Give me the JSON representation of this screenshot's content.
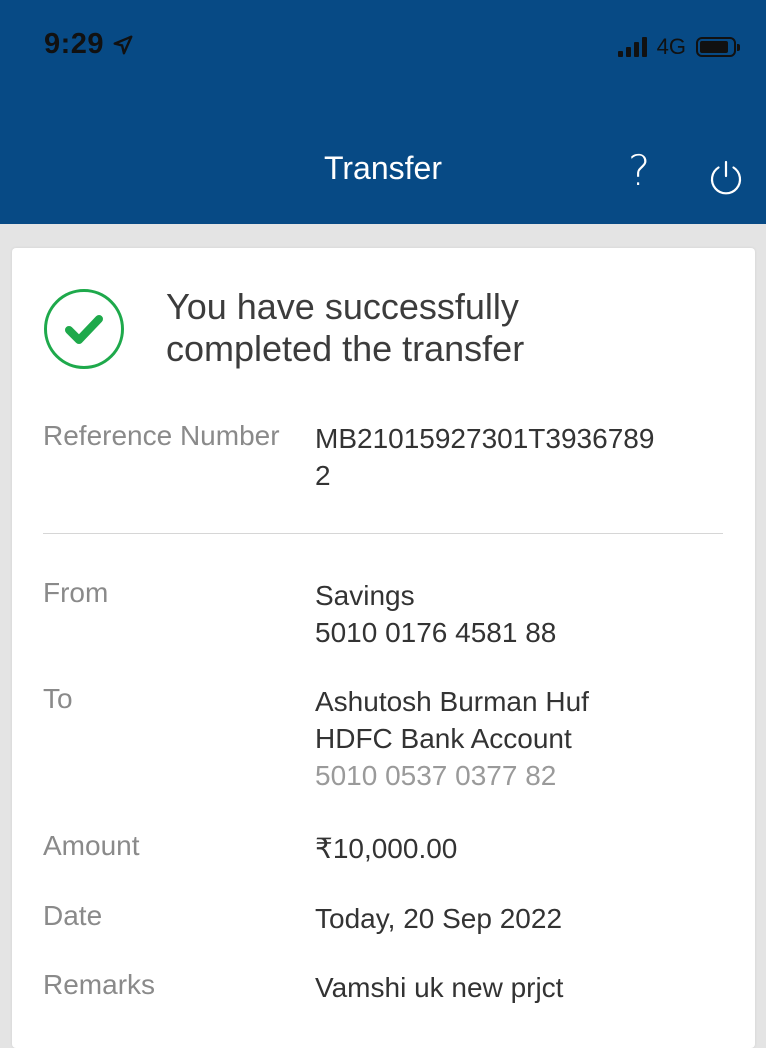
{
  "status_bar": {
    "time": "9:29",
    "network": "4G"
  },
  "header": {
    "title": "Transfer",
    "help_label": "?",
    "background_color": "#074a85"
  },
  "success": {
    "message_line1": "You have successfully",
    "message_line2": "completed the transfer",
    "icon_color": "#1ea94b"
  },
  "details": {
    "reference": {
      "label": "Reference Number",
      "value_line1": "MB21015927301T3936789",
      "value_line2": "2"
    },
    "from": {
      "label": "From",
      "account_type": "Savings",
      "account_number": "5010 0176 4581 88"
    },
    "to": {
      "label": "To",
      "payee_name": "Ashutosh Burman Huf",
      "bank": "HDFC Bank Account",
      "account_number": "5010 0537 0377 82"
    },
    "amount": {
      "label": "Amount",
      "value": "₹10,000.00"
    },
    "date": {
      "label": "Date",
      "value": "Today, 20 Sep 2022"
    },
    "remarks": {
      "label": "Remarks",
      "value": "Vamshi uk new prjct"
    }
  }
}
